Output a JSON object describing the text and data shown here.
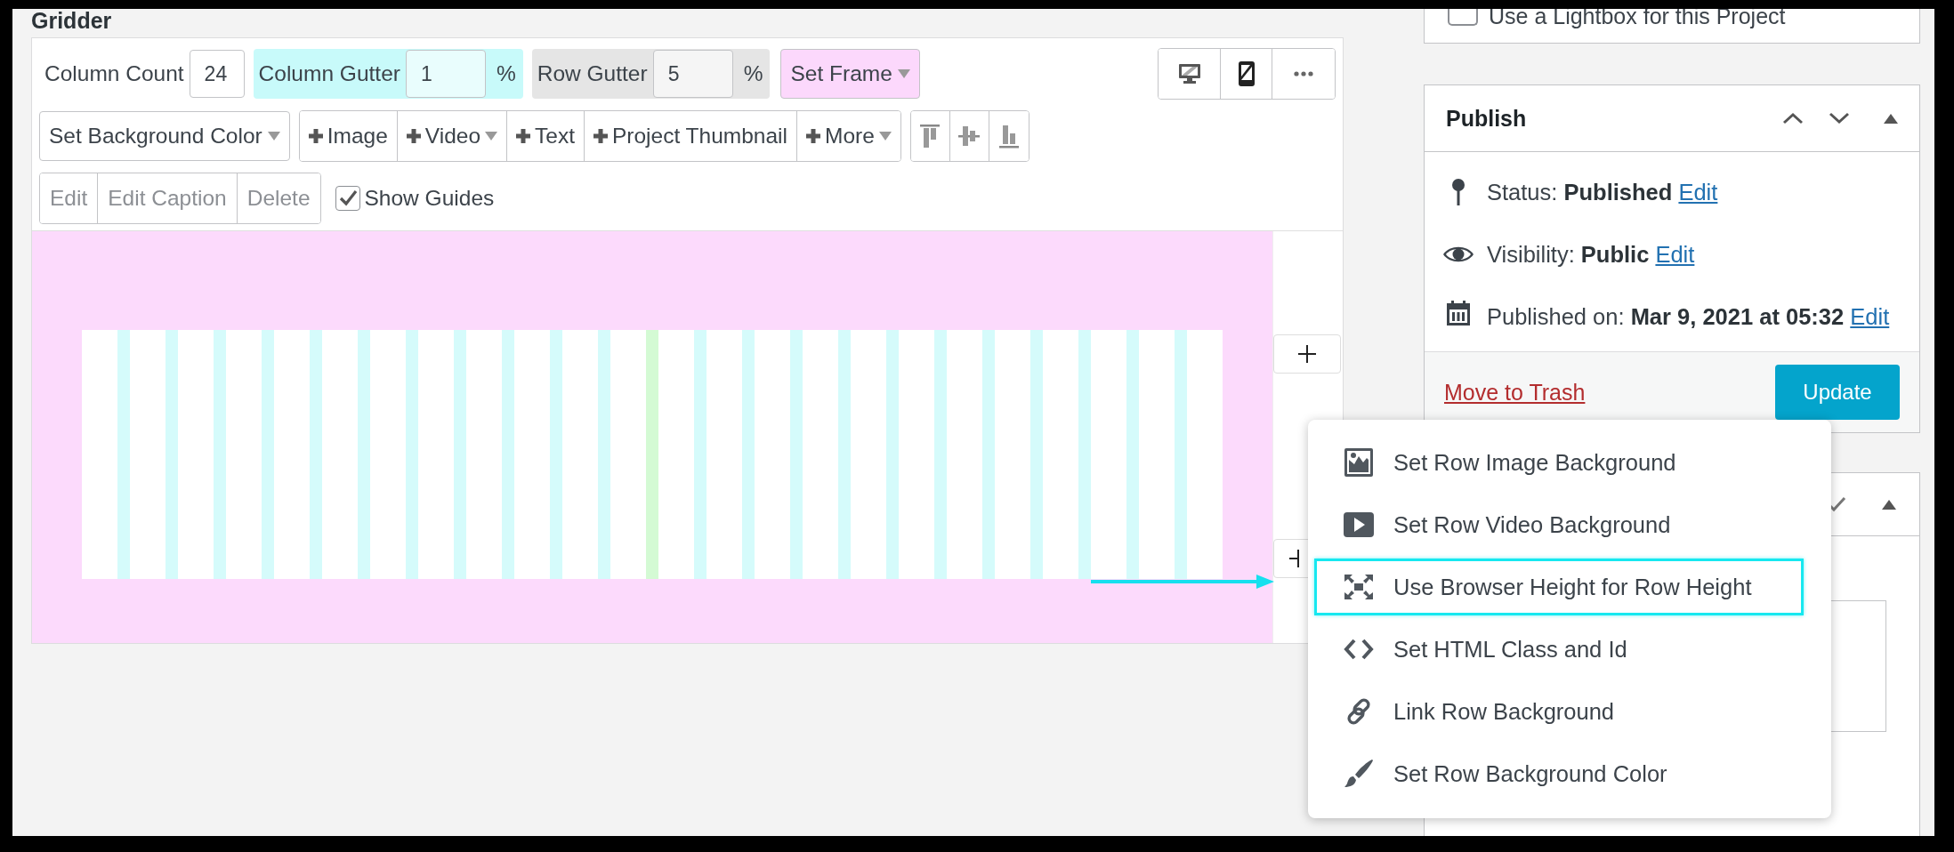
{
  "title": "Gridder",
  "settings": [
    {
      "kind": "field",
      "label": "Column Count",
      "value": "24"
    },
    {
      "kind": "field",
      "label": "Column Gutter",
      "value": "1",
      "unit": "%",
      "color": "#c8fafa"
    },
    {
      "kind": "field",
      "label": "Row Gutter",
      "value": "5",
      "unit": "%",
      "color": "#e5e5e5"
    },
    {
      "kind": "dropdown",
      "label": "Set Frame",
      "color": "#fcd8fc"
    }
  ],
  "view_buttons": [
    {
      "kind": "desktop",
      "selected": false
    },
    {
      "kind": "mobile",
      "selected": true
    },
    {
      "kind": "more",
      "selected": false
    }
  ],
  "background_button": {
    "label": "Set Background Color"
  },
  "add_buttons": [
    {
      "label": "Image",
      "dropdown": false
    },
    {
      "label": "Video",
      "dropdown": true
    },
    {
      "label": "Text",
      "dropdown": false
    },
    {
      "label": "Project Thumbnail",
      "dropdown": false
    },
    {
      "label": "More",
      "dropdown": true
    }
  ],
  "align_buttons": [
    {
      "kind": "top"
    },
    {
      "kind": "middle"
    },
    {
      "kind": "bottom"
    }
  ],
  "edit_buttons": [
    {
      "label": "Edit",
      "disabled": true
    },
    {
      "label": "Edit Caption",
      "disabled": true
    },
    {
      "label": "Delete",
      "disabled": true
    }
  ],
  "show_guides": {
    "label": "Show Guides",
    "checked": true
  },
  "sidebar": {
    "lightbox": {
      "label": "Use a Lightbox for this Project",
      "checked": false
    },
    "publish": {
      "title": "Publish",
      "rows": [
        {
          "kind": "status",
          "text": "Status: **Published**",
          "link": "Edit"
        },
        {
          "kind": "visibility",
          "text": "Visibility: **Public**",
          "link": "Edit"
        },
        {
          "kind": "date",
          "text": "Published on: **Mar 9, 2021 at 05:32**",
          "link": "Edit"
        }
      ],
      "trash": "Move to Trash",
      "update": "Update"
    }
  },
  "context_menu": [
    {
      "kind": "image",
      "label": "Set Row Image Background",
      "selected": false
    },
    {
      "kind": "video",
      "label": "Set Row Video Background",
      "selected": false
    },
    {
      "kind": "expand",
      "label": "Use Browser Height for Row Height",
      "selected": true
    },
    {
      "kind": "code",
      "label": "Set HTML Class and Id",
      "selected": false
    },
    {
      "kind": "link",
      "label": "Link Row Background",
      "selected": false
    },
    {
      "kind": "brush",
      "label": "Set Row Background Color",
      "selected": false
    }
  ]
}
